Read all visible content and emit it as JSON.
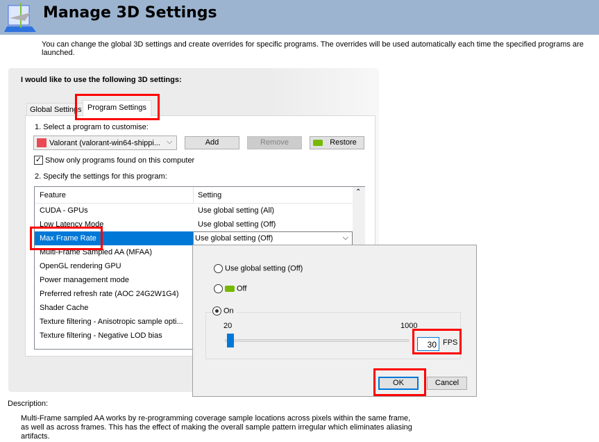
{
  "header": {
    "title": "Manage 3D Settings",
    "icon": "3d-settings-icon",
    "subtitle": "You can change the global 3D settings and create overrides for specific programs. The overrides will be used automatically each time the specified programs are launched."
  },
  "panel": {
    "heading": "I would like to use the following 3D settings:",
    "tabs": [
      {
        "label": "Global Settings"
      },
      {
        "label": "Program Settings",
        "active": true
      }
    ],
    "select_label": "1. Select a program to customise:",
    "program": "Valorant (valorant-win64-shippi...",
    "add": "Add",
    "remove": "Remove",
    "restore": "Restore",
    "show_only": "Show only programs found on this computer",
    "show_only_checked": true,
    "specify_label": "2. Specify the settings for this program:",
    "columns": [
      "Feature",
      "Setting"
    ],
    "rows": [
      {
        "feature": "CUDA - GPUs",
        "setting": "Use global setting (All)"
      },
      {
        "feature": "Low Latency Mode",
        "setting": "Use global setting (Off)"
      },
      {
        "feature": "Max Frame Rate",
        "setting": "Use global setting (Off)",
        "selected": true
      },
      {
        "feature": "Multi-Frame Sampled AA (MFAA)",
        "setting": ""
      },
      {
        "feature": "OpenGL rendering GPU",
        "setting": ""
      },
      {
        "feature": "Power management mode",
        "setting": ""
      },
      {
        "feature": "Preferred refresh rate (AOC 24G2W1G4)",
        "setting": ""
      },
      {
        "feature": "Shader Cache",
        "setting": ""
      },
      {
        "feature": "Texture filtering - Anisotropic sample opti...",
        "setting": ""
      },
      {
        "feature": "Texture filtering - Negative LOD bias",
        "setting": ""
      }
    ]
  },
  "popup": {
    "opt_global": "Use global setting (Off)",
    "opt_off": "Off",
    "opt_on": "On",
    "selected": "On",
    "min": "20",
    "max": "1000",
    "value": "30",
    "unit": "FPS",
    "ok": "OK",
    "cancel": "Cancel"
  },
  "description": {
    "label": "Description:",
    "text": "Multi-Frame sampled AA works by re-programming coverage sample locations across pixels within the same frame, as well as across frames. This has the effect of making the overall sample pattern irregular which eliminates aliasing artifacts."
  },
  "colors": {
    "header": "#9cb4d0",
    "selection": "#0078d7",
    "highlight": "#ff0000",
    "nvidia": "#76b900"
  }
}
